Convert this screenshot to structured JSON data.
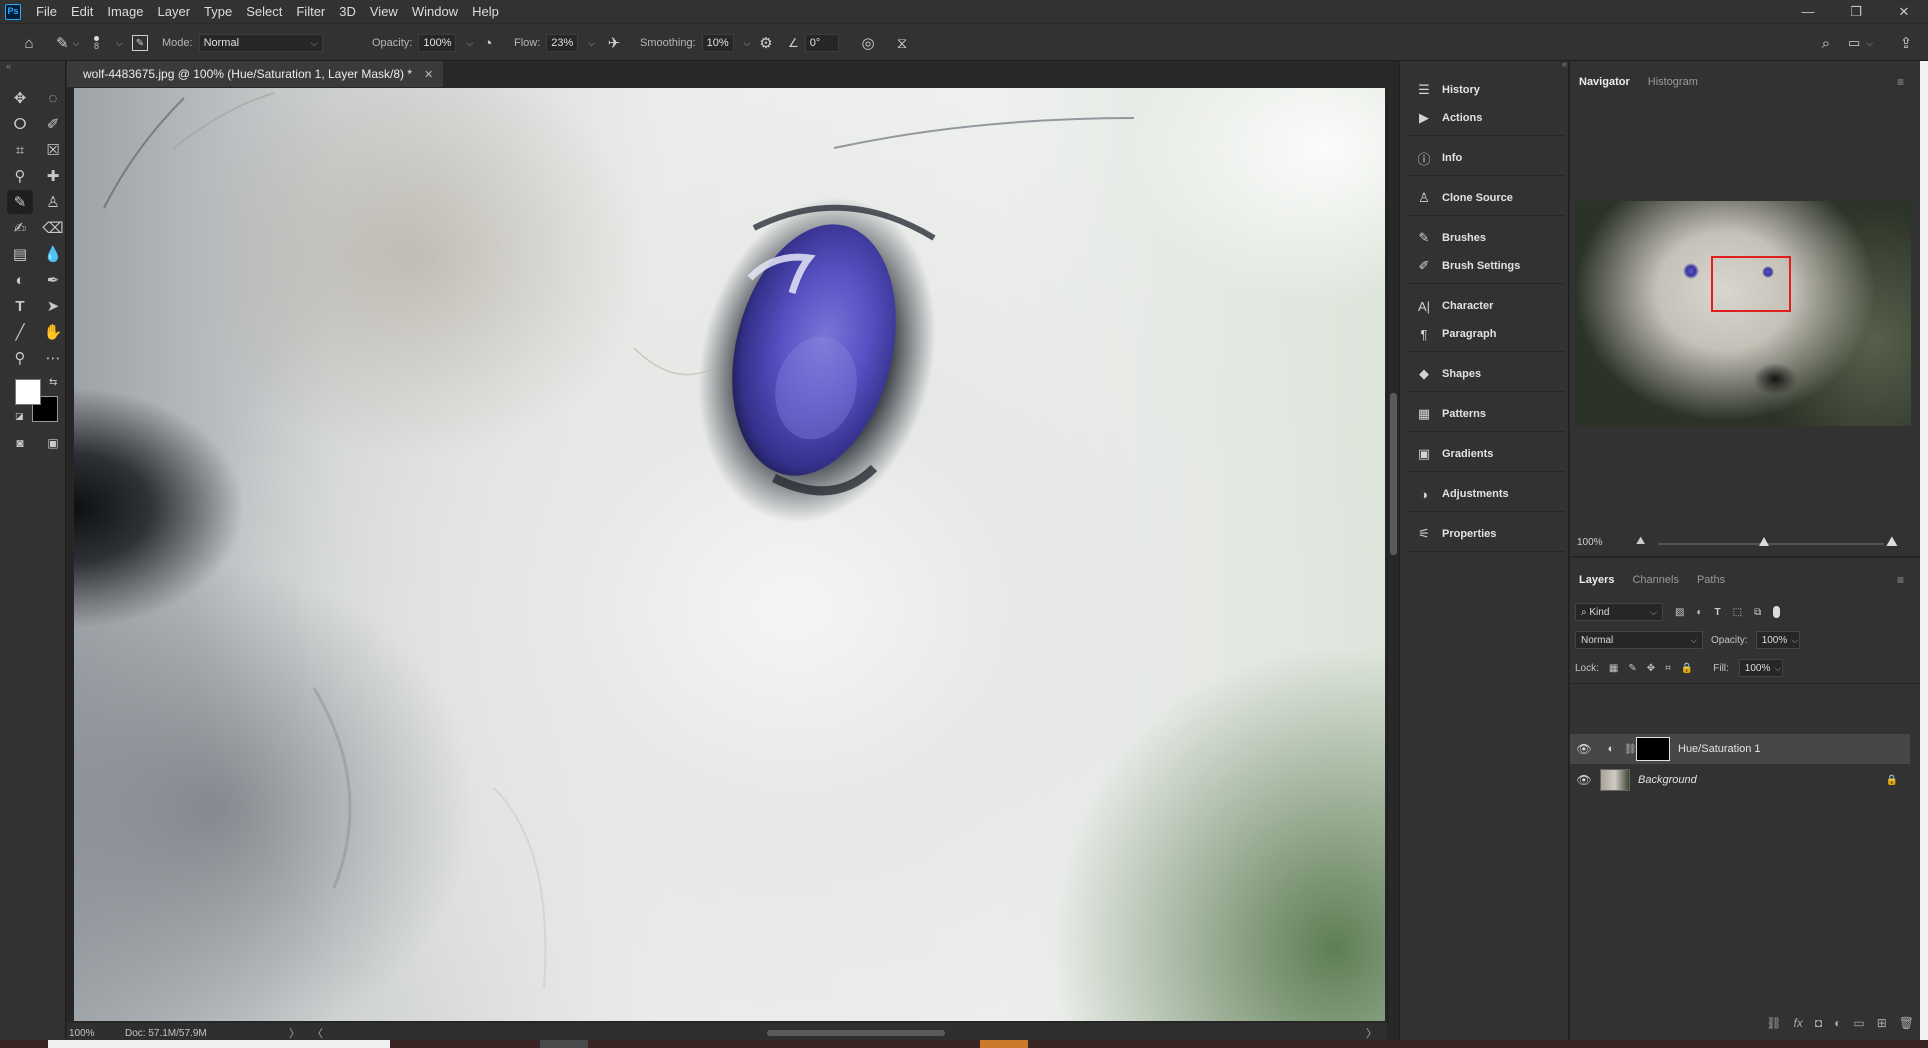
{
  "app": {
    "logo_text": "Ps"
  },
  "menu": [
    "File",
    "Edit",
    "Image",
    "Layer",
    "Type",
    "Select",
    "Filter",
    "3D",
    "View",
    "Window",
    "Help"
  ],
  "window_controls": {
    "minimize": "—",
    "restore": "❐",
    "close": "✕"
  },
  "options_bar": {
    "brush_size": "8",
    "mode_label": "Mode:",
    "mode_value": "Normal",
    "opacity_label": "Opacity:",
    "opacity_value": "100%",
    "flow_label": "Flow:",
    "flow_value": "23%",
    "smoothing_label": "Smoothing:",
    "smoothing_value": "10%",
    "angle_value": "0°"
  },
  "document": {
    "tab_title": "wolf-4483675.jpg @ 100% (Hue/Saturation 1, Layer Mask/8) *",
    "zoom": "100%",
    "doc_size": "Doc: 57.1M/57.9M"
  },
  "collapsed_panels": [
    {
      "icon": "history-icon",
      "label": "History"
    },
    {
      "icon": "actions-icon",
      "label": "Actions"
    },
    {
      "icon": "info-icon",
      "label": "Info"
    },
    {
      "icon": "clone-source-icon",
      "label": "Clone Source"
    },
    {
      "icon": "brushes-icon",
      "label": "Brushes"
    },
    {
      "icon": "brush-settings-icon",
      "label": "Brush Settings"
    },
    {
      "icon": "character-icon",
      "label": "Character"
    },
    {
      "icon": "paragraph-icon",
      "label": "Paragraph"
    },
    {
      "icon": "shapes-icon",
      "label": "Shapes"
    },
    {
      "icon": "patterns-icon",
      "label": "Patterns"
    },
    {
      "icon": "gradients-icon",
      "label": "Gradients"
    },
    {
      "icon": "adjustments-icon",
      "label": "Adjustments"
    },
    {
      "icon": "properties-icon",
      "label": "Properties"
    }
  ],
  "navigator": {
    "tabs": [
      "Navigator",
      "Histogram"
    ],
    "zoom": "100%",
    "view_box_color": "#e02020"
  },
  "layers": {
    "tabs": [
      "Layers",
      "Channels",
      "Paths"
    ],
    "filter_kind": "Kind",
    "blend_mode": "Normal",
    "opacity_label": "Opacity:",
    "opacity_value": "100%",
    "lock_label": "Lock:",
    "fill_label": "Fill:",
    "fill_value": "100%",
    "items": [
      {
        "name": "Hue/Saturation 1",
        "selected": true
      },
      {
        "name": "Background",
        "selected": false
      }
    ]
  },
  "colors": {
    "accent": "#31a8ff",
    "foreground": "#ffffff",
    "background": "#000000",
    "eye_tint": "#5a57c8"
  }
}
